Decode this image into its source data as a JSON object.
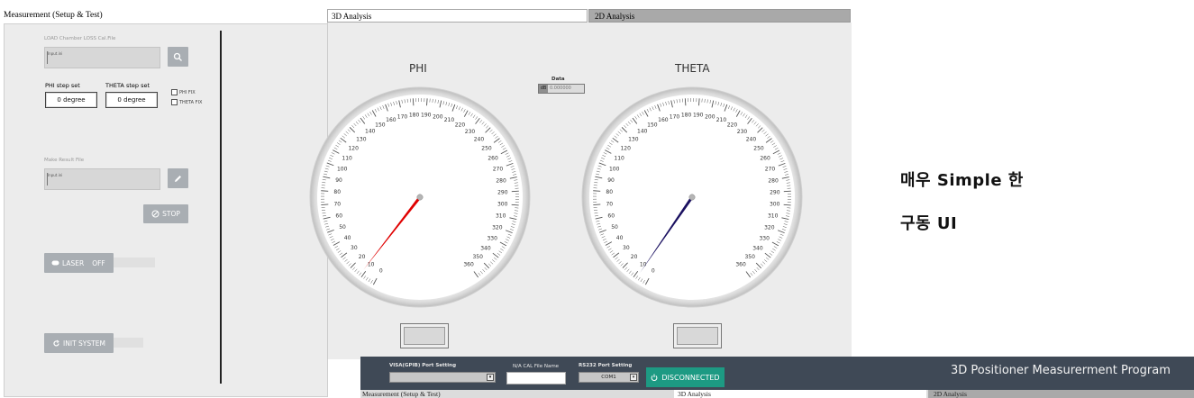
{
  "left_panel": {
    "title": "Measurement (Setup & Test)",
    "cal_file_label": "LOAD Chamber LOSS Cal.File",
    "path_stub": "Input.ini",
    "phi_step_label": "PHI step set",
    "theta_step_label": "THETA step set",
    "phi_step_value": "0 degree",
    "theta_step_value": "0 degree",
    "phi_fix_label": "PHI FIX",
    "theta_fix_label": "THETA FIX",
    "result_file_label": "Make Result File",
    "result_stub": "Input.ini",
    "stop_label": "STOP",
    "laser_label": "LASER",
    "laser_state": "OFF",
    "init_label": "INIT SYSTEM"
  },
  "tabs": [
    "3D Analysis",
    "2D Analysis"
  ],
  "data_panel": {
    "label": "Data",
    "prefix": "dB",
    "value": "0.000000"
  },
  "gauges": {
    "phi": {
      "title": "PHI",
      "value": 12,
      "min": 0,
      "max": 360,
      "needle_color": "#e00000"
    },
    "theta": {
      "title": "THETA",
      "value": 8,
      "min": 0,
      "max": 360,
      "needle_color": "#1a1060"
    },
    "major_labels": [
      0,
      10,
      20,
      30,
      40,
      50,
      60,
      70,
      80,
      90,
      100,
      110,
      120,
      130,
      140,
      150,
      160,
      170,
      180,
      190,
      200,
      210,
      220,
      230,
      240,
      250,
      260,
      270,
      280,
      290,
      300,
      310,
      320,
      330,
      340,
      350,
      360
    ]
  },
  "note": {
    "line1": "매우 Simple 한",
    "line2": "구동 UI"
  },
  "bottom_bar": {
    "visa_label": "VISA(GPIB) Port Setting",
    "cal_name_label": "N/A CAL File Name",
    "rs232_label": "RS232 Port Setting",
    "com_value": "COM1",
    "disconnected_label": "DISCONNECTED",
    "program_title": "3D Positioner Measurerment Program"
  },
  "bottom_strip": {
    "title": "Measurement (Setup & Test)",
    "tab3d": "3D Analysis",
    "tab2d": "2D Analysis"
  }
}
